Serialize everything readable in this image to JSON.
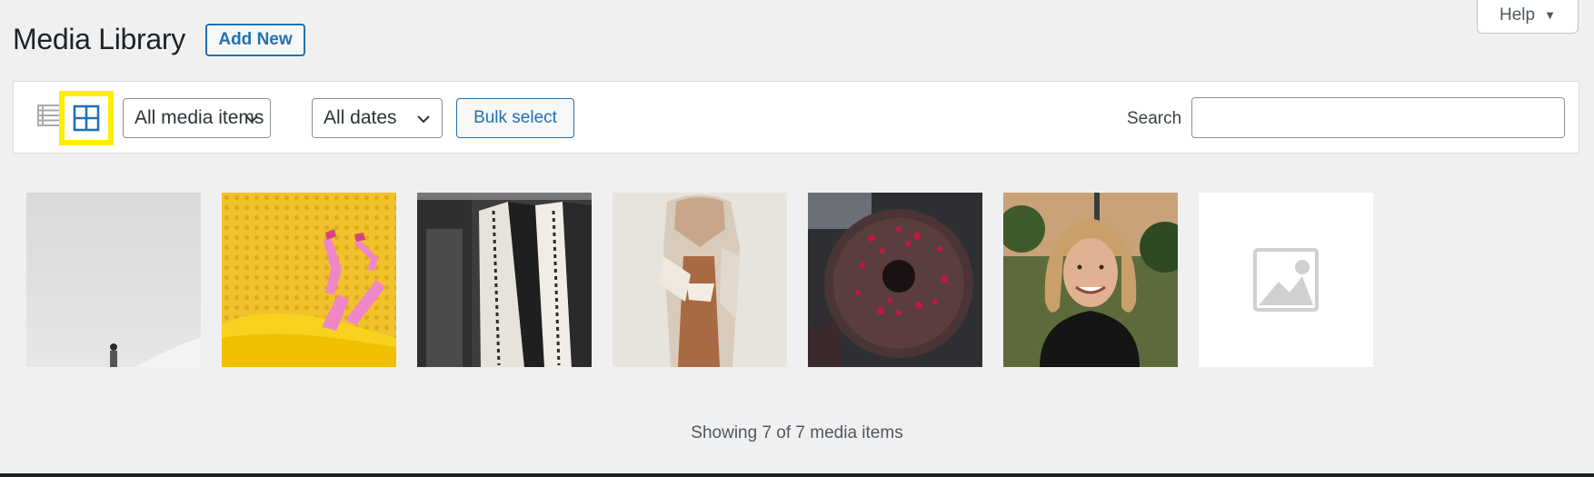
{
  "header": {
    "title": "Media Library",
    "add_new_label": "Add New",
    "help_label": "Help"
  },
  "toolbar": {
    "view_modes": [
      "list-view-icon",
      "grid-view-icon"
    ],
    "active_view": "grid",
    "media_type_filter": {
      "selected": "All media items"
    },
    "date_filter": {
      "selected": "All dates"
    },
    "bulk_select_label": "Bulk select",
    "search_label": "Search",
    "search_value": ""
  },
  "media_items": [
    {
      "name": "person-in-white-room-thumbnail"
    },
    {
      "name": "pink-legs-yellow-tub-thumbnail"
    },
    {
      "name": "clothing-rack-thumbnail"
    },
    {
      "name": "woman-in-robe-thumbnail"
    },
    {
      "name": "chocolate-donut-thumbnail"
    },
    {
      "name": "smiling-woman-portrait-thumbnail"
    },
    {
      "name": "placeholder-image-thumbnail"
    }
  ],
  "footer": {
    "count_text": "Showing 7 of 7 media items"
  },
  "colors": {
    "accent": "#2271b1",
    "highlight": "#ffee00",
    "background": "#f0f0f1"
  }
}
